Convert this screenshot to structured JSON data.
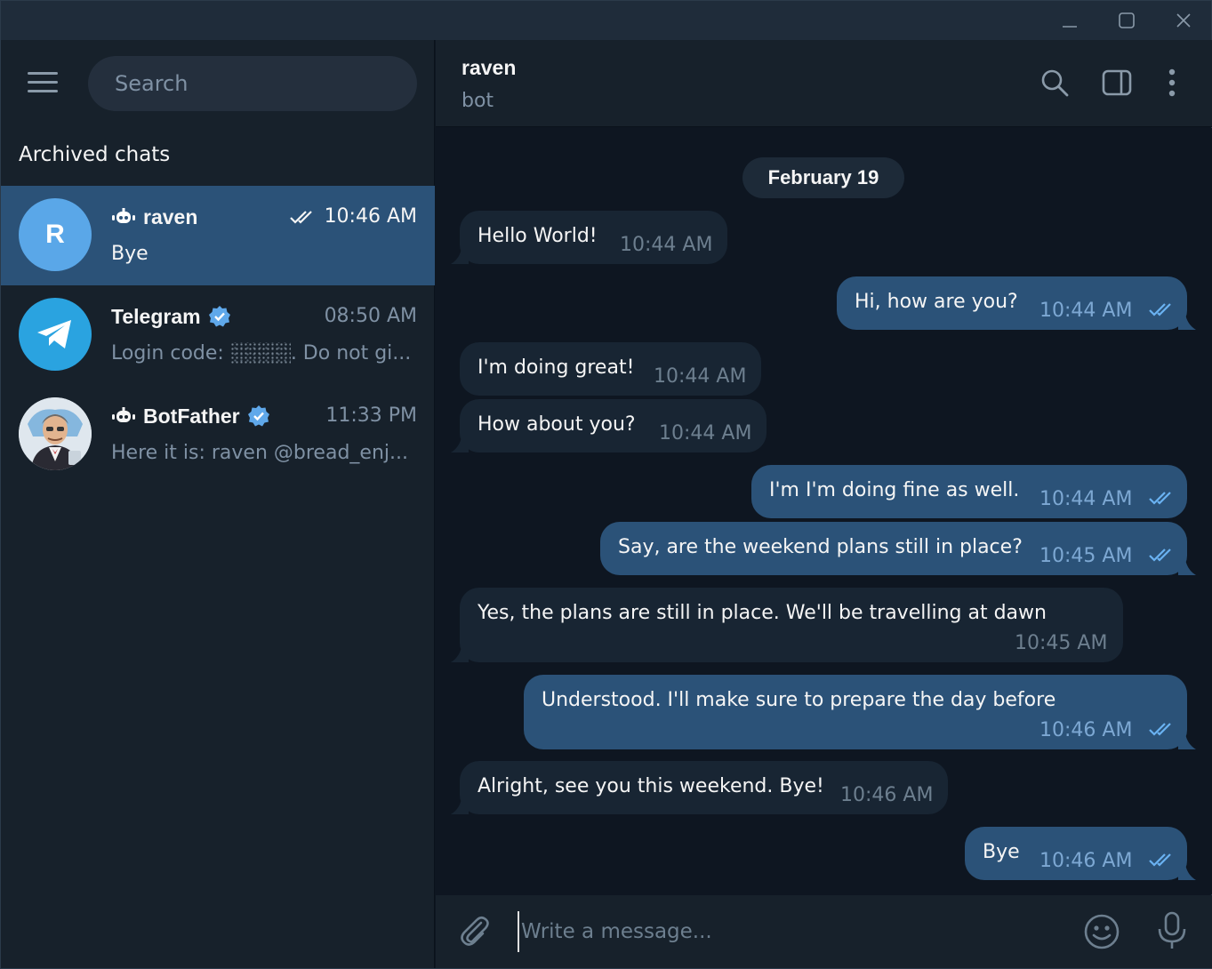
{
  "window": {
    "controls": [
      "minimize",
      "maximize",
      "close"
    ]
  },
  "sidebar": {
    "search_placeholder": "Search",
    "section_title": "Archived chats",
    "chats": [
      {
        "name": "raven",
        "time": "10:46 AM",
        "preview": "Bye",
        "avatar_letter": "R",
        "is_bot": true,
        "verified": false,
        "read": true,
        "active": true,
        "avatar_color": "#5aa7e8"
      },
      {
        "name": "Telegram",
        "time": "08:50 AM",
        "preview_prefix": "Login code:",
        "preview_suffix": ". Do not gi...",
        "is_bot": false,
        "verified": true,
        "active": false,
        "avatar_color": "#2aa3e0"
      },
      {
        "name": "BotFather",
        "time": "11:33 PM",
        "preview": "Here it is: raven @bread_enj...",
        "is_bot": true,
        "verified": true,
        "active": false
      }
    ]
  },
  "header": {
    "title": "raven",
    "subtitle": "bot",
    "icons": [
      "search-icon",
      "sidebar-toggle-icon",
      "more-vertical-icon"
    ]
  },
  "messages": {
    "date": "February 19",
    "items": [
      {
        "dir": "in",
        "text": "Hello World!",
        "time": "10:44 AM"
      },
      {
        "dir": "out",
        "text": "Hi, how are you?",
        "time": "10:44 AM",
        "read": true
      },
      {
        "dir": "in",
        "text": "I'm doing great!",
        "time": "10:44 AM"
      },
      {
        "dir": "in",
        "text": "How about you?",
        "time": "10:44 AM"
      },
      {
        "dir": "out",
        "text": "I'm I'm doing fine as well.",
        "time": "10:44 AM",
        "read": true
      },
      {
        "dir": "out",
        "text": "Say, are the weekend plans still in place?",
        "time": "10:45 AM",
        "read": true
      },
      {
        "dir": "in",
        "text": "Yes, the plans are still in place. We'll be travelling at dawn",
        "time": "10:45 AM"
      },
      {
        "dir": "out",
        "text": "Understood. I'll make sure to prepare the day before",
        "time": "10:46 AM",
        "read": true
      },
      {
        "dir": "in",
        "text": "Alright, see you this weekend. Bye!",
        "time": "10:46 AM"
      },
      {
        "dir": "out",
        "text": "Bye",
        "time": "10:46 AM",
        "read": true
      }
    ]
  },
  "composer": {
    "placeholder": "Write a message..."
  },
  "colors": {
    "accent": "#2b5278",
    "sidebar_bg": "#17212b",
    "chat_bg": "#0e1621",
    "incoming": "#182533",
    "check_blue": "#6ab2f2"
  }
}
